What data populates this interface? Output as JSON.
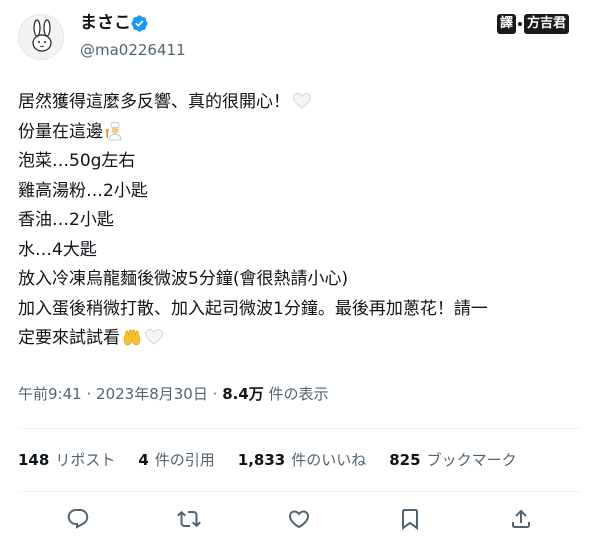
{
  "author": {
    "display_name": "まさこ",
    "handle": "@ma0226411",
    "verified": true
  },
  "watermark": {
    "left": "譯",
    "right": "方吉君"
  },
  "tweet": {
    "lines": [
      "居然獲得這麼多反響、真的很開心！",
      "份量在這邊",
      "泡菜…50g左右",
      "雞高湯粉…2小匙",
      "香油…2小匙",
      "水…4大匙",
      "放入冷凍烏龍麵後微波5分鐘(會很熱請小心)",
      "加入蛋後稍微打散、加入起司微波1分鐘。最後再加蔥花！請一",
      "定要來試試看"
    ],
    "emoji": [
      "white-heart",
      "cook",
      "raising-hands",
      "white-heart"
    ]
  },
  "meta": {
    "time": "午前9:41",
    "sep1": "·",
    "date": "2023年8月30日",
    "sep2": "·",
    "views": "8.4万",
    "views_label": "件の表示"
  },
  "stats": [
    {
      "count": "148",
      "label": "リポスト"
    },
    {
      "count": "4",
      "label": "件の引用"
    },
    {
      "count": "1,833",
      "label": "件のいいね"
    },
    {
      "count": "825",
      "label": "ブックマーク"
    }
  ],
  "colors": {
    "text": "#0f1419",
    "secondary": "#536471",
    "divider": "#eff3f4",
    "verified": "#1d9bf0"
  },
  "icons": [
    "reply-icon",
    "retweet-icon",
    "like-icon",
    "bookmark-icon",
    "share-icon"
  ]
}
